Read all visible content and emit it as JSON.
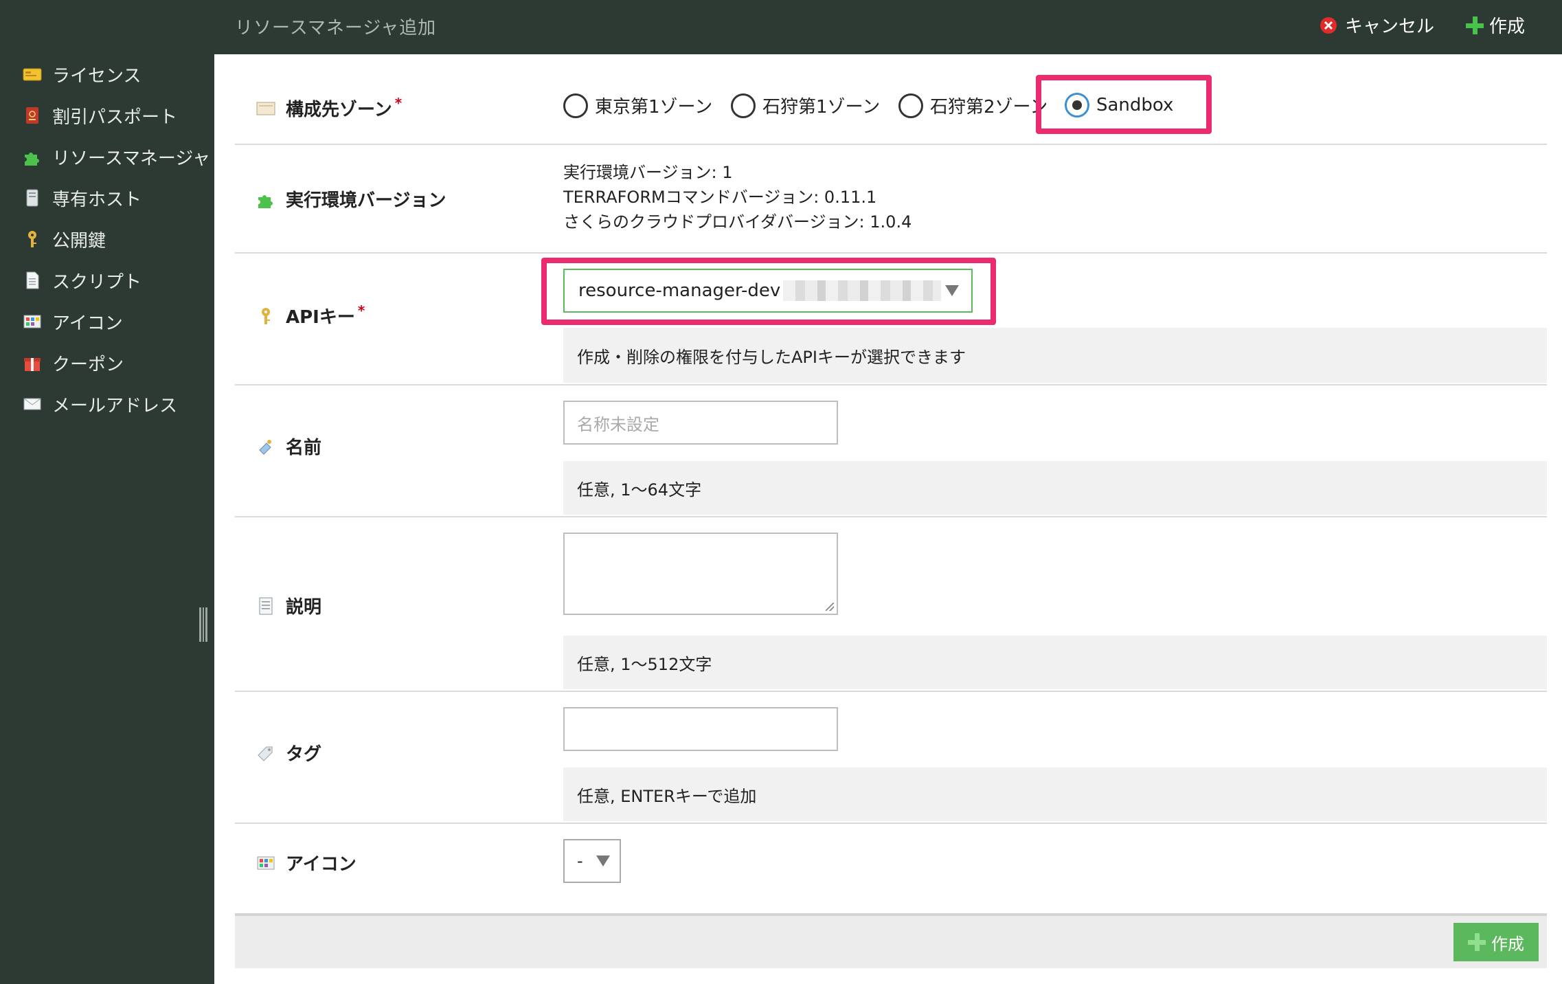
{
  "header": {
    "title": "リソースマネージャ追加",
    "cancel_label": "キャンセル",
    "create_label": "作成"
  },
  "sidebar": {
    "items": [
      {
        "label": "ライセンス",
        "icon": "license-icon"
      },
      {
        "label": "割引パスポート",
        "icon": "passport-icon"
      },
      {
        "label": "リソースマネージャ",
        "icon": "puzzle-icon"
      },
      {
        "label": "専有ホスト",
        "icon": "server-icon"
      },
      {
        "label": "公開鍵",
        "icon": "key-icon"
      },
      {
        "label": "スクリプト",
        "icon": "document-icon"
      },
      {
        "label": "アイコン",
        "icon": "icon-palette-icon"
      },
      {
        "label": "クーポン",
        "icon": "gift-icon"
      },
      {
        "label": "メールアドレス",
        "icon": "mail-icon"
      }
    ]
  },
  "form": {
    "zone": {
      "label": "構成先ゾーン",
      "required_mark": "*",
      "options": [
        "東京第1ゾーン",
        "石狩第1ゾーン",
        "石狩第2ゾーン",
        "Sandbox"
      ],
      "selected": "Sandbox"
    },
    "runtime": {
      "label": "実行環境バージョン",
      "line1": "実行環境バージョン: 1",
      "line2": "TERRAFORMコマンドバージョン: 0.11.1",
      "line3": "さくらのクラウドプロバイダバージョン: 1.0.4"
    },
    "api_key": {
      "label": "APIキー",
      "required_mark": "*",
      "selected_value": "resource-manager-dev",
      "help": "作成・削除の権限を付与したAPIキーが選択できます"
    },
    "name": {
      "label": "名前",
      "placeholder": "名称未設定",
      "help": "任意, 1〜64文字"
    },
    "description": {
      "label": "説明",
      "help": "任意, 1〜512文字"
    },
    "tags": {
      "label": "タグ",
      "help": "任意, ENTERキーで追加"
    },
    "icon": {
      "label": "アイコン",
      "selected_value": "-"
    }
  },
  "footer": {
    "create_label": "作成"
  },
  "colors": {
    "sidebar_bg": "#2c3a33",
    "accent_green": "#5cb85c",
    "highlight_pink": "#ec2a6f",
    "required_red": "#d0021b"
  }
}
